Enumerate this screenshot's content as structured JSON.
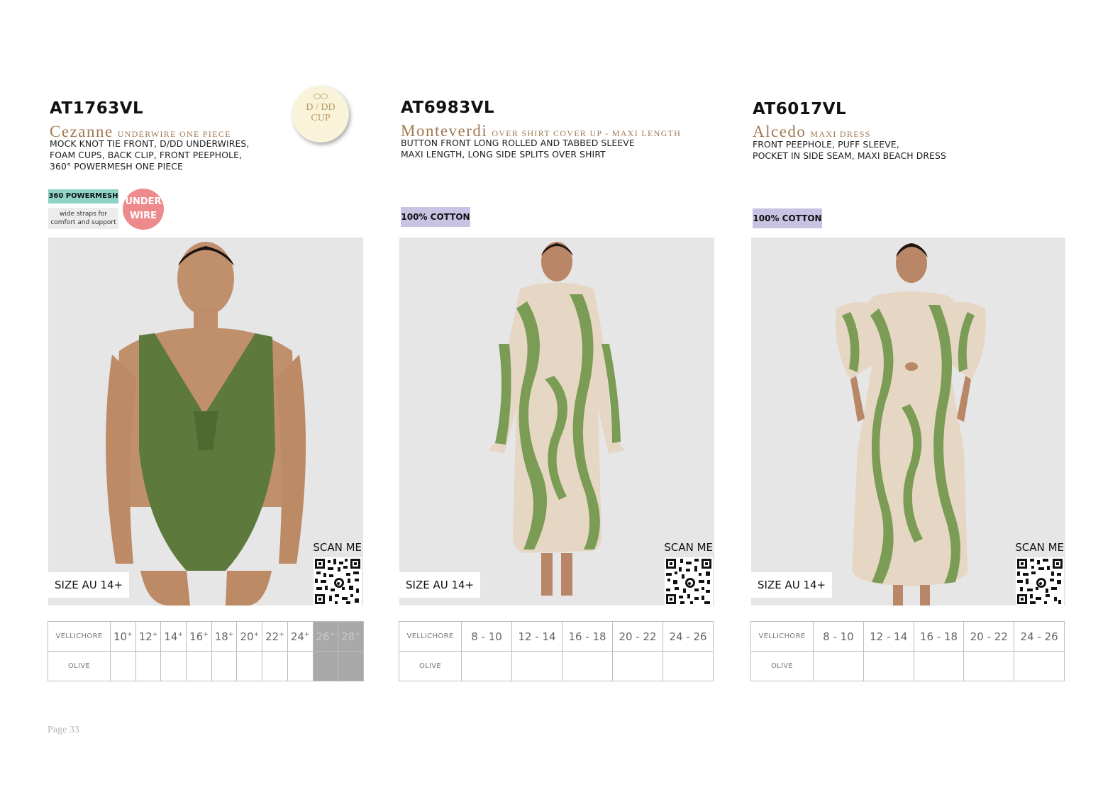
{
  "products": [
    {
      "code": "AT1763VL",
      "style_name": "Cezanne",
      "style_type": "UNDERWIRE ONE PIECE",
      "description": [
        "MOCK KNOT TIE FRONT, D/DD UNDERWIRES,",
        "FOAM CUPS, BACK CLIP, FRONT PEEPHOLE,",
        "360° POWERMESH ONE PIECE"
      ],
      "badge_cup": {
        "line1": "D / DD",
        "line2": "CUP"
      },
      "tag_mesh": "360 POWERMESH",
      "tag_straps": [
        "wide straps for",
        "comfort and support"
      ],
      "badge_under": {
        "line1": "UNDER",
        "line2": "WIRE"
      },
      "size_label": "SIZE AU 14+",
      "scan_label": "SCAN ME",
      "size_header_label": "VELLICHORE",
      "sizes": [
        "10",
        "12",
        "14",
        "16",
        "18",
        "20",
        "22",
        "24",
        "26",
        "28"
      ],
      "sizes_unavailable": [
        "26",
        "28"
      ],
      "colour": "OLIVE",
      "garment_colour": "#5d7a3c"
    },
    {
      "code": "AT6983VL",
      "style_name": "Monteverdi",
      "style_type": "OVER SHIRT COVER UP - MAXI LENGTH",
      "description": [
        "BUTTON FRONT LONG ROLLED AND TABBED SLEEVE",
        "MAXI LENGTH, LONG SIDE SPLITS OVER SHIRT"
      ],
      "tag_fabric": "100% COTTON",
      "size_label": "SIZE AU 14+",
      "scan_label": "SCAN ME",
      "size_header_label": "VELLICHORE",
      "sizes": [
        "8 - 10",
        "12 - 14",
        "16 - 18",
        "20 - 22",
        "24 - 26"
      ],
      "colour": "OLIVE",
      "garment_colour": "#7a9c55"
    },
    {
      "code": "AT6017VL",
      "style_name": "Alcedo",
      "style_type": "MAXI DRESS",
      "description": [
        "FRONT PEEPHOLE, PUFF SLEEVE,",
        "POCKET IN SIDE SEAM, MAXI BEACH DRESS"
      ],
      "tag_fabric": "100% COTTON",
      "size_label": "SIZE AU 14+",
      "scan_label": "SCAN ME",
      "size_header_label": "VELLICHORE",
      "sizes": [
        "8 - 10",
        "12 - 14",
        "16 - 18",
        "20 - 22",
        "24 - 26"
      ],
      "colour": "OLIVE",
      "garment_colour": "#7a9c55"
    }
  ],
  "page_number": "Page 33"
}
